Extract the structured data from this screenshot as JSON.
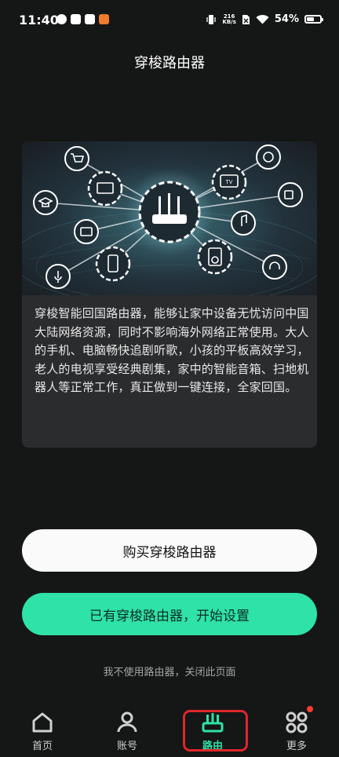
{
  "status_bar": {
    "time": "11:40",
    "net_speed_value": "216",
    "net_speed_unit": "KB/s",
    "battery_percent": "54%",
    "battery_level": 0.54
  },
  "page": {
    "title": "穿梭路由器"
  },
  "card": {
    "description": "穿梭智能回国路由器，能够让家中设备无忧访问中国大陆网络资源，同时不影响海外网络正常使用。大人的手机、电脑畅快追剧听歌，小孩的平板高效学习，老人的电视享受经典剧集，家中的智能音箱、扫地机器人等正常工作，真正做到一键连接，全家回国。",
    "hero_tv_label": "TV"
  },
  "buttons": {
    "buy": "购买穿梭路由器",
    "setup": "已有穿梭路由器，开始设置"
  },
  "close_link": "我不使用路由器，关闭此页面",
  "tabs": [
    {
      "label": "首页",
      "icon": "home-icon"
    },
    {
      "label": "账号",
      "icon": "user-icon"
    },
    {
      "label": "路由",
      "icon": "router-icon"
    },
    {
      "label": "更多",
      "icon": "more-grid-icon"
    }
  ],
  "colors": {
    "background": "#151616",
    "card": "#2b2c2e",
    "accent": "#2ee2a8",
    "highlight_box": "#e0262b",
    "badge": "#ff3b30"
  }
}
